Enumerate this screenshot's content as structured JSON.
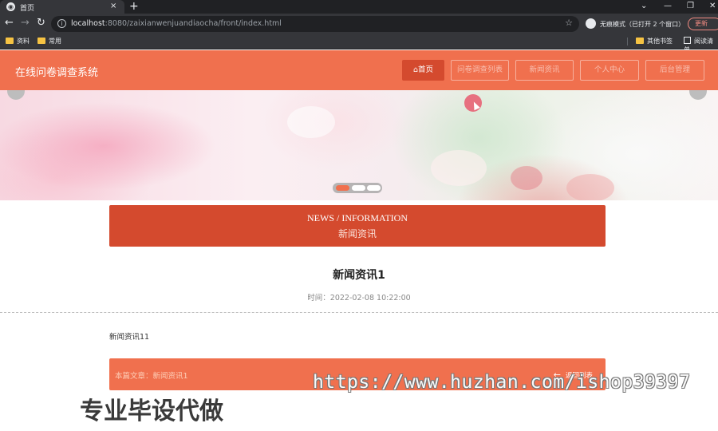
{
  "browser": {
    "tab_title": "首页",
    "tab_close": "×",
    "new_tab": "+",
    "window_controls": [
      "⌄",
      "—",
      "❐",
      "✕"
    ],
    "url_host": "localhost",
    "url_rest": ":8080/zaixianwenjuandiaocha/front/index.html",
    "incognito_text": "无痕模式（已打开 2 个窗口）",
    "update_label": "更新",
    "bookmarks_left": [
      "资料",
      "常用"
    ],
    "bookmarks_right": [
      "其他书签",
      "阅读清单"
    ]
  },
  "site": {
    "title": "在线问卷调查系统",
    "nav": [
      {
        "label": "⌂首页",
        "active": true
      },
      {
        "label": "问卷调查列表",
        "active": false
      },
      {
        "label": "新闻资讯",
        "active": false
      },
      {
        "label": "个人中心",
        "active": false
      },
      {
        "label": "后台管理",
        "active": false
      }
    ]
  },
  "carousel": {
    "slides": 3,
    "active_index": 0
  },
  "news": {
    "heading_en": "NEWS / INFORMATION",
    "heading_cn": "新闻资讯",
    "article_title": "新闻资讯1",
    "time_label": "时间：2022-02-08 10:22:00",
    "body": "新闻资讯11",
    "footer_label": "本篇文章：新闻资讯1",
    "back_label": "返回列表"
  },
  "colors": {
    "primary": "#f0704e",
    "accent": "#d44a2e"
  },
  "watermark": {
    "url": "https://www.huzhan.com/ishop39397",
    "cn": "专业毕设代做"
  }
}
